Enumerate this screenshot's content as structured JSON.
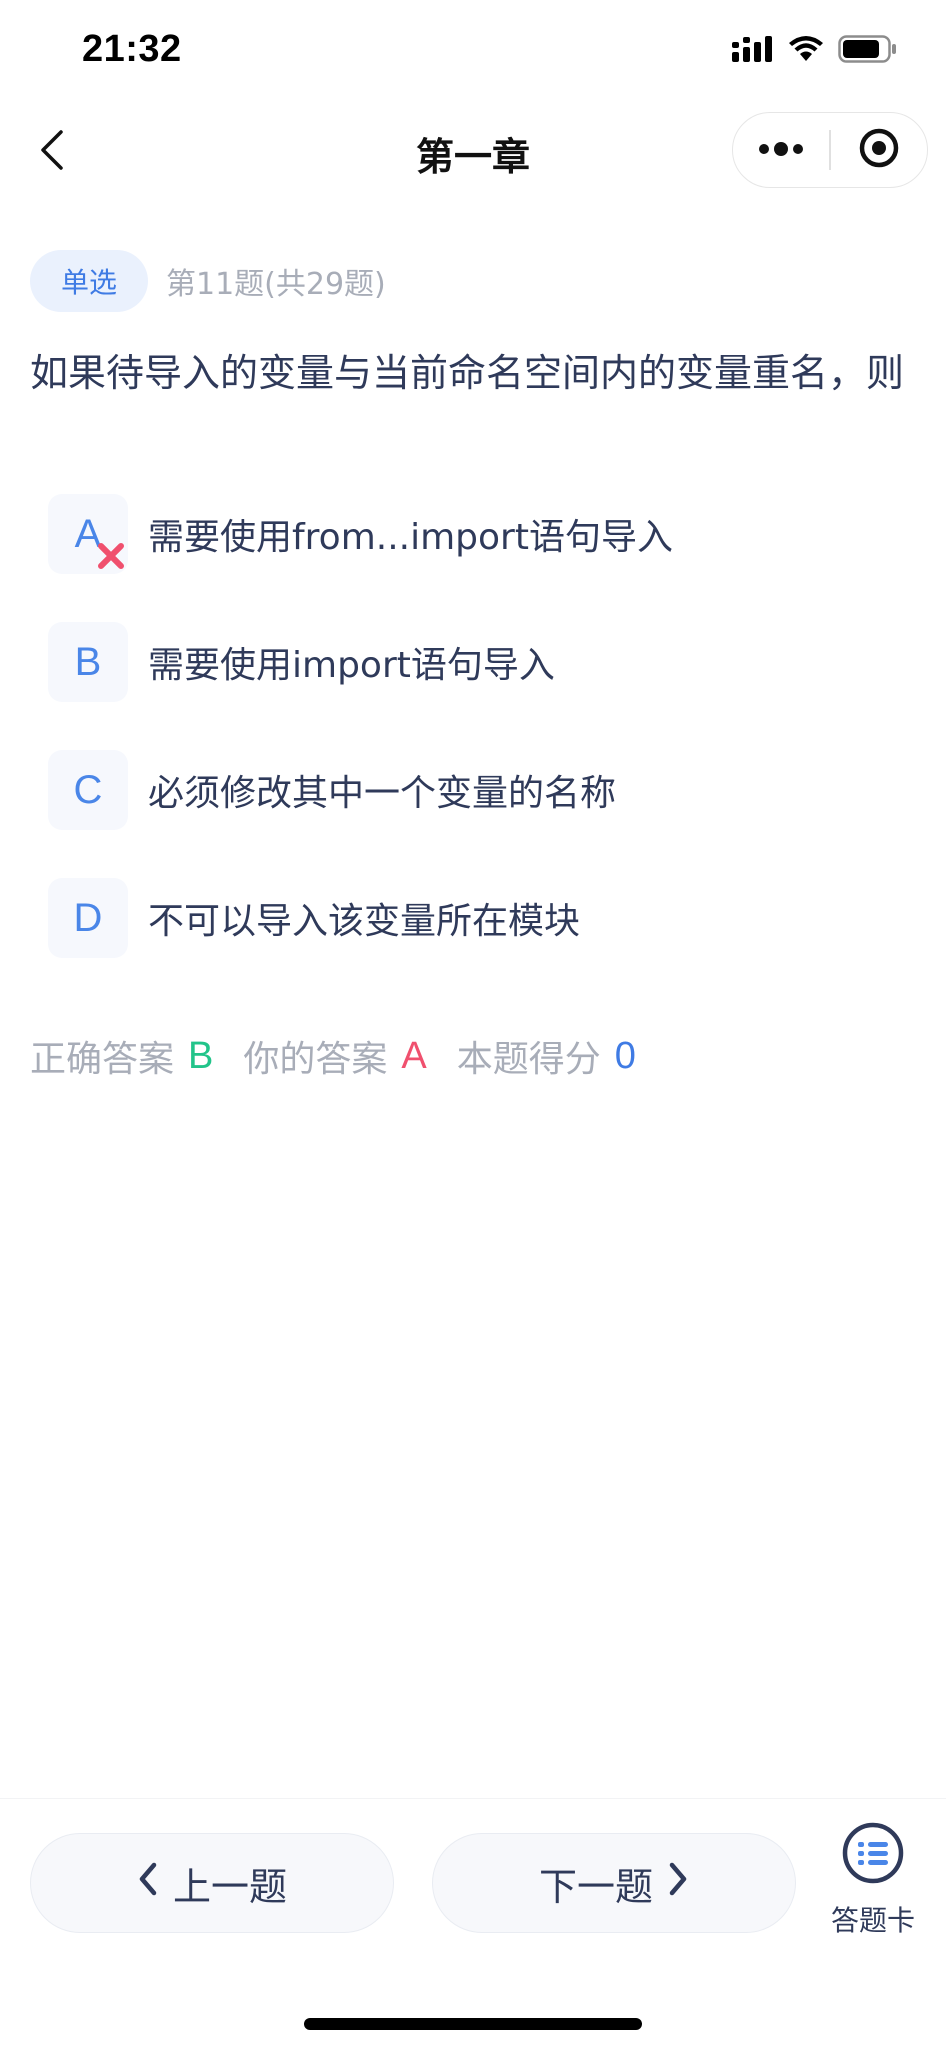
{
  "status_bar": {
    "time": "21:32"
  },
  "nav": {
    "title": "第一章"
  },
  "question": {
    "type_badge": "单选",
    "index_text": "第11题(共29题)",
    "text": "如果待导入的变量与当前命名空间内的变量重名，则",
    "options": [
      {
        "key": "A",
        "text": "需要使用from...import语句导入",
        "marked_wrong": true
      },
      {
        "key": "B",
        "text": "需要使用import语句导入",
        "marked_wrong": false
      },
      {
        "key": "C",
        "text": "必须修改其中一个变量的名称",
        "marked_wrong": false
      },
      {
        "key": "D",
        "text": "不可以导入该变量所在模块",
        "marked_wrong": false
      }
    ]
  },
  "result": {
    "correct_label": "正确答案",
    "correct_value": "B",
    "mine_label": "你的答案",
    "mine_value": "A",
    "score_label": "本题得分",
    "score_value": "0"
  },
  "bottom": {
    "prev_label": "上一题",
    "next_label": "下一题",
    "card_label": "答题卡"
  },
  "colors": {
    "accent": "#3f7be4",
    "correct": "#22c48a",
    "wrong": "#f0506e",
    "text": "#2f3a5a",
    "muted": "#a8adb8"
  }
}
